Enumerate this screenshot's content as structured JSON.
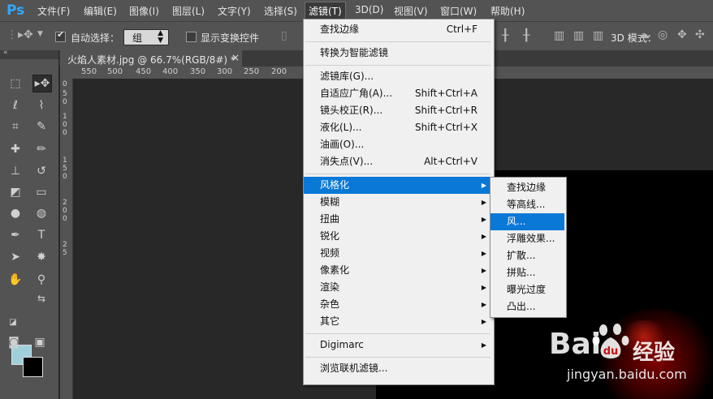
{
  "app": {
    "logo": "Ps"
  },
  "menubar": [
    {
      "label": "文件(F)"
    },
    {
      "label": "编辑(E)"
    },
    {
      "label": "图像(I)"
    },
    {
      "label": "图层(L)"
    },
    {
      "label": "文字(Y)"
    },
    {
      "label": "选择(S)"
    },
    {
      "label": "滤镜(T)",
      "active": true
    },
    {
      "label": "3D(D)"
    },
    {
      "label": "视图(V)"
    },
    {
      "label": "窗口(W)"
    },
    {
      "label": "帮助(H)"
    }
  ],
  "options": {
    "auto_select_label": "自动选择：",
    "auto_select_checked": true,
    "auto_select_value": "组",
    "show_transform_label": "显示变换控件",
    "show_transform_checked": false,
    "mode_3d_label": "3D 模式："
  },
  "document": {
    "tab_title": "火焰人素材.jpg @ 66.7%(RGB/8#) *",
    "close_glyph": "×",
    "zoom": "66.7%"
  },
  "ruler": {
    "h": [
      "550",
      "500",
      "450",
      "400",
      "350",
      "300",
      "250",
      "200"
    ],
    "v": [
      "0",
      "5",
      "0",
      "1",
      "0",
      "0",
      "1",
      "5",
      "0",
      "2",
      "0",
      "0",
      "2",
      "5"
    ]
  },
  "filter_menu": {
    "items": [
      {
        "label": "查找边缘",
        "shortcut": "Ctrl+F"
      },
      {
        "sep": true
      },
      {
        "label": "转换为智能滤镜"
      },
      {
        "sep": true
      },
      {
        "label": "滤镜库(G)..."
      },
      {
        "label": "自适应广角(A)...",
        "shortcut": "Shift+Ctrl+A"
      },
      {
        "label": "镜头校正(R)...",
        "shortcut": "Shift+Ctrl+R"
      },
      {
        "label": "液化(L)...",
        "shortcut": "Shift+Ctrl+X"
      },
      {
        "label": "油画(O)..."
      },
      {
        "label": "消失点(V)...",
        "shortcut": "Alt+Ctrl+V"
      },
      {
        "sep": true
      },
      {
        "label": "风格化",
        "submenu": true,
        "highlight": true
      },
      {
        "label": "模糊",
        "submenu": true
      },
      {
        "label": "扭曲",
        "submenu": true
      },
      {
        "label": "锐化",
        "submenu": true
      },
      {
        "label": "视频",
        "submenu": true
      },
      {
        "label": "像素化",
        "submenu": true
      },
      {
        "label": "渲染",
        "submenu": true
      },
      {
        "label": "杂色",
        "submenu": true
      },
      {
        "label": "其它",
        "submenu": true
      },
      {
        "sep": true
      },
      {
        "label": "Digimarc",
        "submenu": true
      },
      {
        "sep": true
      },
      {
        "label": "浏览联机滤镜..."
      }
    ]
  },
  "stylize_submenu": {
    "items": [
      {
        "label": "查找边缘"
      },
      {
        "label": "等高线..."
      },
      {
        "label": "风...",
        "highlight": true
      },
      {
        "label": "浮雕效果..."
      },
      {
        "label": "扩散..."
      },
      {
        "label": "拼贴..."
      },
      {
        "label": "曝光过度"
      },
      {
        "label": "凸出..."
      }
    ]
  },
  "watermark": {
    "brand": "Bai",
    "product": "经验",
    "url": "jingyan.baidu.com"
  },
  "colors": {
    "accent": "#0a78d7",
    "foreground_swatch": "#9fcfda",
    "background_swatch": "#000000",
    "chrome": "#535353"
  }
}
